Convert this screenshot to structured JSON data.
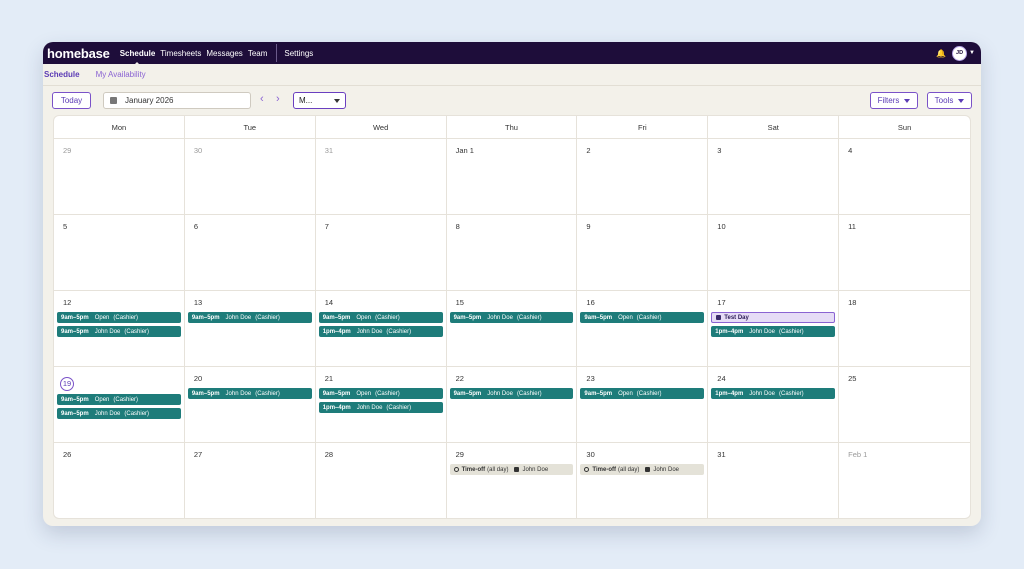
{
  "app": {
    "logo": "homebase",
    "nav": [
      "Schedule",
      "Timesheets",
      "Messages",
      "Team",
      "Settings"
    ],
    "avatar_initials": "JD"
  },
  "subtabs": [
    "Schedule",
    "My Availability"
  ],
  "toolbar": {
    "today_label": "Today",
    "date_label": "January 2026",
    "view_label": "M...",
    "filters_label": "Filters",
    "tools_label": "Tools"
  },
  "colors": {
    "nav_bg": "#1e0d3a",
    "accent": "#6a3fc0",
    "shift": "#1e7c7a",
    "event_bg": "#e6dcf6",
    "timeoff_bg": "#e4e2d8"
  },
  "days_of_week": [
    "Mon",
    "Tue",
    "Wed",
    "Thu",
    "Fri",
    "Sat",
    "Sun"
  ],
  "weeks": [
    [
      {
        "date": "29",
        "other": true,
        "events": []
      },
      {
        "date": "30",
        "other": true,
        "events": []
      },
      {
        "date": "31",
        "other": true,
        "events": []
      },
      {
        "date": "Jan 1",
        "events": []
      },
      {
        "date": "2",
        "events": []
      },
      {
        "date": "3",
        "events": []
      },
      {
        "date": "4",
        "events": []
      }
    ],
    [
      {
        "date": "5",
        "events": []
      },
      {
        "date": "6",
        "events": []
      },
      {
        "date": "7",
        "events": []
      },
      {
        "date": "8",
        "events": []
      },
      {
        "date": "9",
        "events": []
      },
      {
        "date": "10",
        "events": []
      },
      {
        "date": "11",
        "events": []
      }
    ],
    [
      {
        "date": "12",
        "events": [
          {
            "kind": "shift",
            "time": "9am–5pm",
            "name": "Open",
            "role": "(Cashier)"
          },
          {
            "kind": "shift",
            "time": "9am–5pm",
            "name": "John Doe",
            "role": "(Cashier)"
          }
        ]
      },
      {
        "date": "13",
        "events": [
          {
            "kind": "shift",
            "time": "9am–5pm",
            "name": "John Doe",
            "role": "(Cashier)"
          }
        ]
      },
      {
        "date": "14",
        "events": [
          {
            "kind": "shift",
            "time": "9am–5pm",
            "name": "Open",
            "role": "(Cashier)"
          },
          {
            "kind": "shift",
            "time": "1pm–4pm",
            "name": "John Doe",
            "role": "(Cashier)"
          }
        ]
      },
      {
        "date": "15",
        "events": [
          {
            "kind": "shift",
            "time": "9am–5pm",
            "name": "John Doe",
            "role": "(Cashier)"
          }
        ]
      },
      {
        "date": "16",
        "events": [
          {
            "kind": "shift",
            "time": "9am–5pm",
            "name": "Open",
            "role": "(Cashier)"
          }
        ]
      },
      {
        "date": "17",
        "events": [
          {
            "kind": "event",
            "title": "Test Day"
          },
          {
            "kind": "shift",
            "time": "1pm–4pm",
            "name": "John Doe",
            "role": "(Cashier)"
          }
        ]
      },
      {
        "date": "18",
        "events": []
      }
    ],
    [
      {
        "date": "19",
        "today": true,
        "events": [
          {
            "kind": "shift",
            "time": "9am–5pm",
            "name": "Open",
            "role": "(Cashier)"
          },
          {
            "kind": "shift",
            "time": "9am–5pm",
            "name": "John Doe",
            "role": "(Cashier)"
          }
        ]
      },
      {
        "date": "20",
        "events": [
          {
            "kind": "shift",
            "time": "9am–5pm",
            "name": "John Doe",
            "role": "(Cashier)"
          }
        ]
      },
      {
        "date": "21",
        "events": [
          {
            "kind": "shift",
            "time": "9am–5pm",
            "name": "Open",
            "role": "(Cashier)"
          },
          {
            "kind": "shift",
            "time": "1pm–4pm",
            "name": "John Doe",
            "role": "(Cashier)"
          }
        ]
      },
      {
        "date": "22",
        "events": [
          {
            "kind": "shift",
            "time": "9am–5pm",
            "name": "John Doe",
            "role": "(Cashier)"
          }
        ]
      },
      {
        "date": "23",
        "events": [
          {
            "kind": "shift",
            "time": "9am–5pm",
            "name": "Open",
            "role": "(Cashier)"
          }
        ]
      },
      {
        "date": "24",
        "events": [
          {
            "kind": "shift",
            "time": "1pm–4pm",
            "name": "John Doe",
            "role": "(Cashier)"
          }
        ]
      },
      {
        "date": "25",
        "events": []
      }
    ],
    [
      {
        "date": "26",
        "events": []
      },
      {
        "date": "27",
        "events": []
      },
      {
        "date": "28",
        "events": []
      },
      {
        "date": "29",
        "events": [
          {
            "kind": "timeoff",
            "label": "Time-off",
            "detail": "(all day)",
            "person": "John Doe"
          }
        ]
      },
      {
        "date": "30",
        "events": [
          {
            "kind": "timeoff",
            "label": "Time-off",
            "detail": "(all day)",
            "person": "John Doe"
          }
        ]
      },
      {
        "date": "31",
        "events": []
      },
      {
        "date": "Feb 1",
        "other": true,
        "events": []
      }
    ]
  ]
}
